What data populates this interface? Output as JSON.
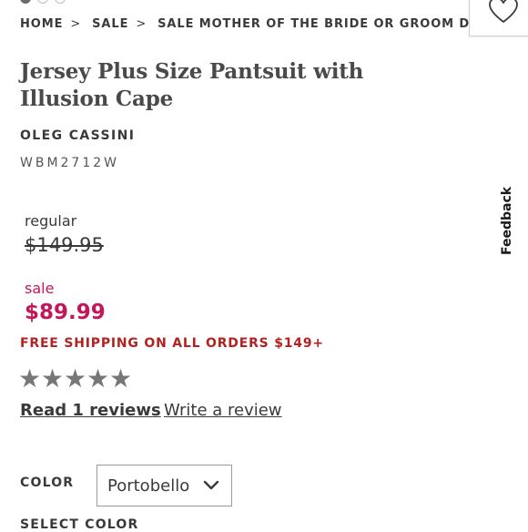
{
  "breadcrumb": {
    "items": [
      "HOME",
      "SALE",
      "SALE MOTHER OF THE BRIDE OR GROOM DRESSES"
    ],
    "separator": ">"
  },
  "product": {
    "title": "Jersey Plus Size Pantsuit with Illusion Cape",
    "brand": "OLEG CASSINI",
    "sku": "WBM2712W"
  },
  "pricing": {
    "regular_label": "regular",
    "regular_price": "$149.95",
    "sale_label": "sale",
    "sale_price": "$89.99"
  },
  "promo": {
    "shipping": "FREE SHIPPING ON ALL ORDERS $149+"
  },
  "reviews": {
    "star_glyphs": [
      "★",
      "★",
      "★",
      "★",
      "★"
    ],
    "read_label": "Read 1 reviews",
    "write_label": "Write a review"
  },
  "options": {
    "color_label": "COLOR",
    "color_value": "Portobello",
    "select_color_label": "SELECT COLOR"
  },
  "side_tab": {
    "feedback_label": "Feedback"
  },
  "icons": {
    "wishlist": "heart-icon",
    "dropdown": "chevron-down-icon"
  },
  "colors": {
    "sale": "#c2185b",
    "shipping": "#b22222",
    "text": "#3a3a3a",
    "stars": "#777777"
  }
}
